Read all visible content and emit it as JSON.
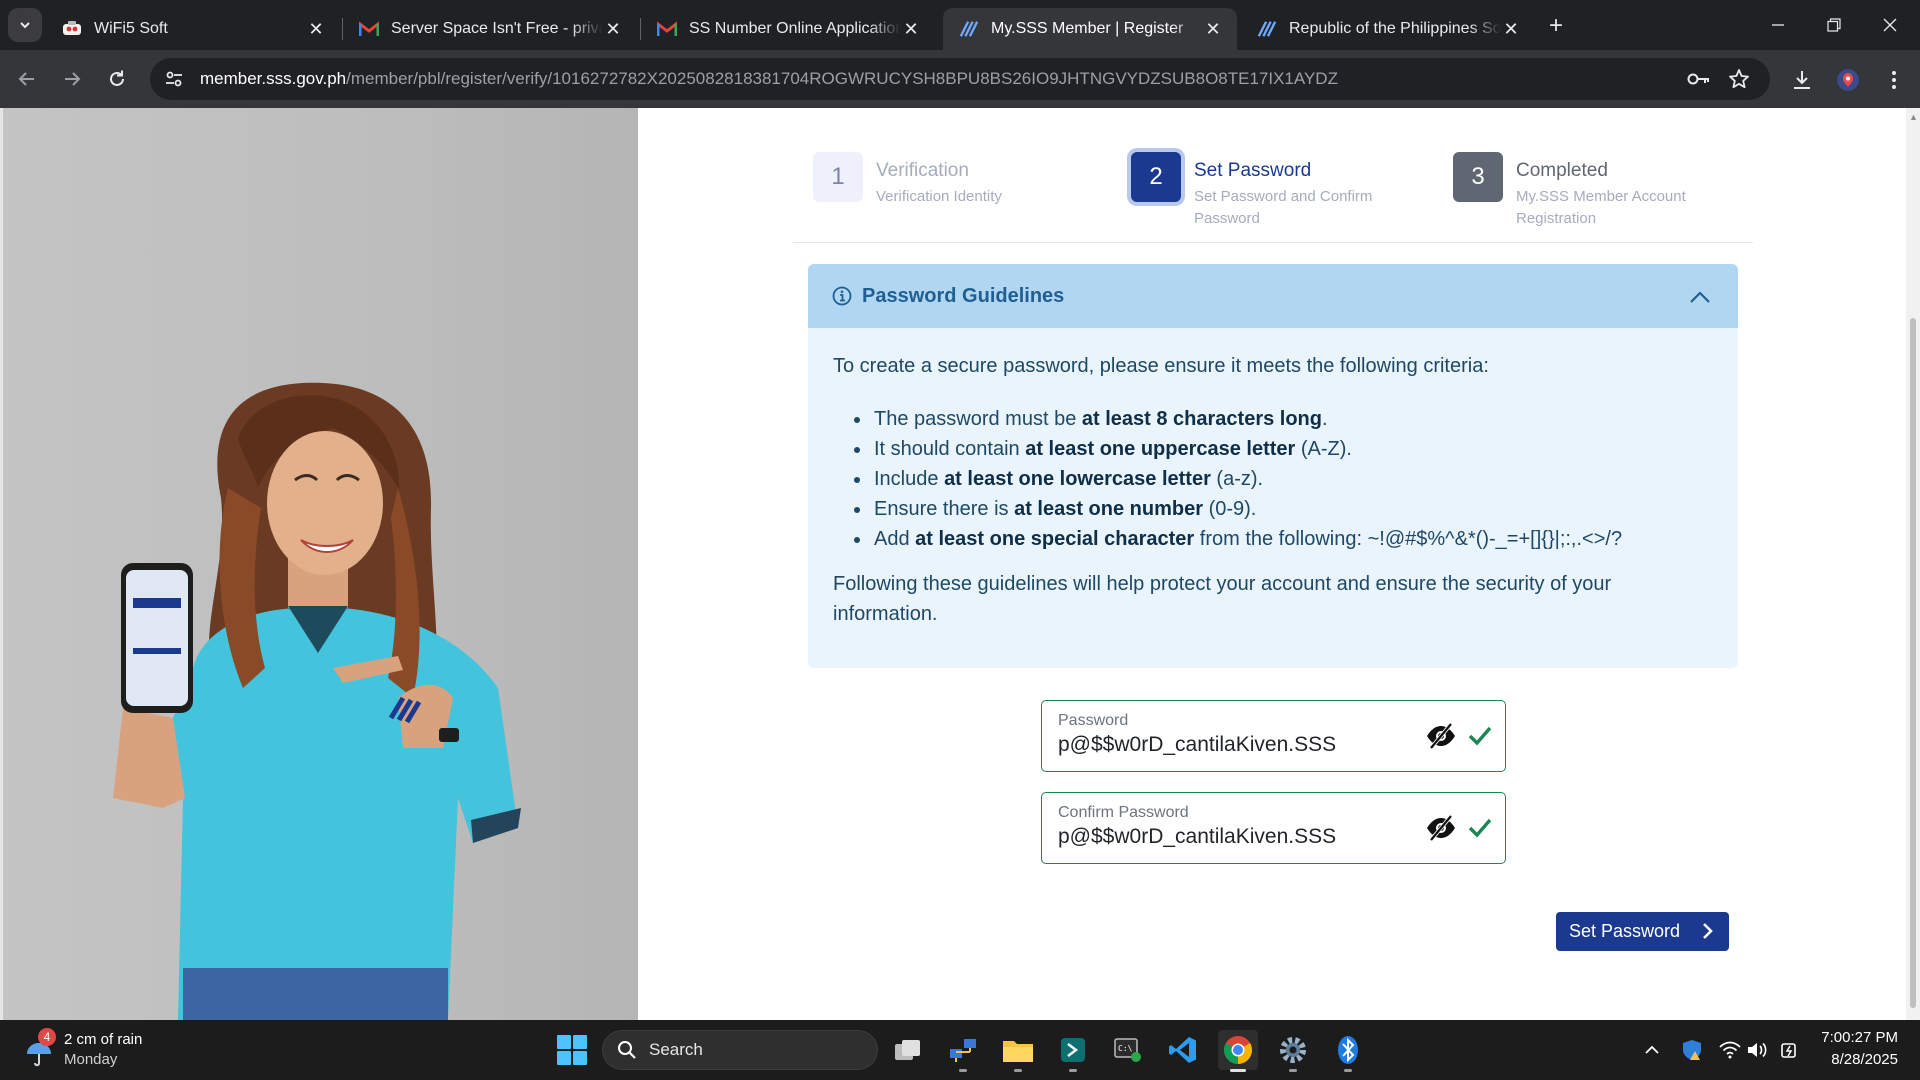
{
  "browser": {
    "tabs": [
      {
        "title": "WiFi5 Soft",
        "icon": "wifi5soft-favicon",
        "active": false
      },
      {
        "title": "Server Space Isn't Free - private",
        "icon": "gmail-icon",
        "active": false
      },
      {
        "title": "SS Number Online Application (",
        "icon": "gmail-icon",
        "active": false
      },
      {
        "title": "My.SSS Member | Register",
        "icon": "sss-favicon",
        "active": true
      },
      {
        "title": "Republic of the Philippines Soci",
        "icon": "sss-favicon",
        "active": false
      }
    ],
    "url_host": "member.sss.gov.ph",
    "url_path": "/member/pbl/register/verify/1016272782X2025082818381704ROGWRUCYSH8BPU8BS26IO9JHTNGVYDZSUB8O8TE17IX1AYDZ"
  },
  "stepper": {
    "steps": [
      {
        "number": "1",
        "title": "Verification",
        "subtitle": "Verification Identity",
        "state": "done"
      },
      {
        "number": "2",
        "title": "Set Password",
        "subtitle": "Set Password and Confirm Password",
        "state": "current"
      },
      {
        "number": "3",
        "title": "Completed",
        "subtitle": "My.SSS Member Account Registration",
        "state": "pending"
      }
    ]
  },
  "guidelines": {
    "title": "Password Guidelines",
    "intro": "To create a secure password, please ensure it meets the following criteria:",
    "items": [
      {
        "before": "The password must be ",
        "bold": "at least 8 characters long",
        "after": "."
      },
      {
        "before": "It should contain ",
        "bold": "at least one uppercase letter",
        "after": " (A-Z)."
      },
      {
        "before": "Include ",
        "bold": "at least one lowercase letter",
        "after": " (a-z)."
      },
      {
        "before": "Ensure there is ",
        "bold": "at least one number",
        "after": " (0-9)."
      },
      {
        "before": "Add ",
        "bold": "at least one special character",
        "after": " from the following: ~!@#$%^&*()-_=+[]{}|;:,.<>/?"
      }
    ],
    "outro": "Following these guidelines will help protect your account and ensure the security of your information."
  },
  "form": {
    "password": {
      "label": "Password",
      "value": "p@$$w0rD_cantilaKiven.SSS"
    },
    "confirm_password": {
      "label": "Confirm Password",
      "value": "p@$$w0rD_cantilaKiven.SSS"
    },
    "submit_label": "Set Password"
  },
  "taskbar": {
    "weather_main": "2 cm of rain",
    "weather_day": "Monday",
    "weather_badge": "4",
    "search_label": "Search",
    "time": "7:00:27 PM",
    "date": "8/28/2025"
  },
  "colors": {
    "sss_blue": "#1b3a8f",
    "guide_header": "#b0d6f2",
    "guide_body": "#eaf4fc",
    "valid_green": "#198754"
  }
}
